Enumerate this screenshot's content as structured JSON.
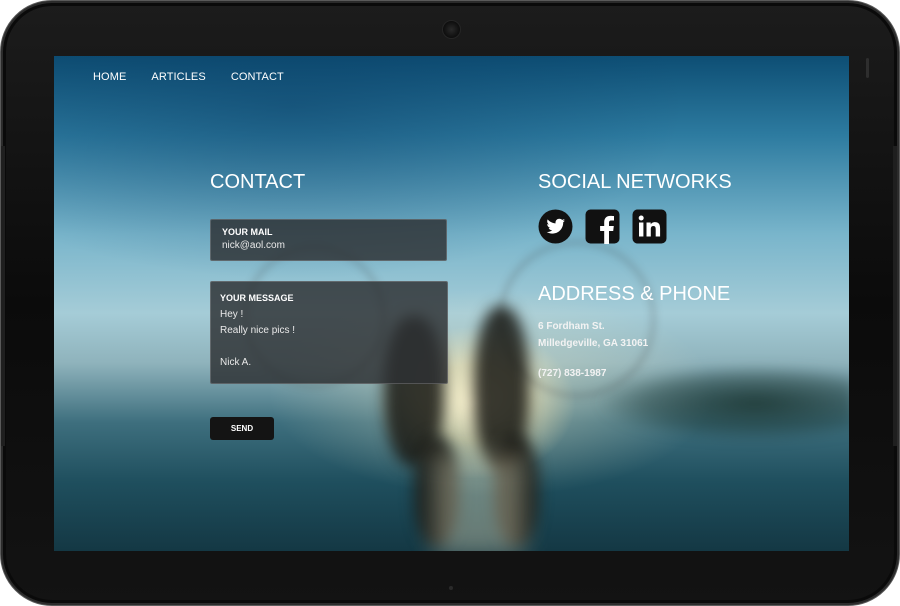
{
  "nav": {
    "items": [
      "HOME",
      "ARTICLES",
      "CONTACT"
    ]
  },
  "contact": {
    "title": "CONTACT",
    "mail_label": "YOUR MAIL",
    "mail_value": "nick@aol.com",
    "message_label": "YOUR MESSAGE",
    "message_value": "Hey !\nReally nice pics !\n\nNick A.",
    "send_label": "SEND"
  },
  "social": {
    "title": "SOCIAL NETWORKS",
    "icons": [
      "twitter-icon",
      "facebook-icon",
      "linkedin-icon"
    ]
  },
  "address": {
    "title": "ADDRESS & PHONE",
    "line1": "6 Fordham St.",
    "line2": "Milledgeville, GA 31061",
    "phone": "(727) 838-1987"
  },
  "colors": {
    "field_bg": "#2d3032",
    "button_bg": "#141414",
    "text": "#ffffff"
  }
}
